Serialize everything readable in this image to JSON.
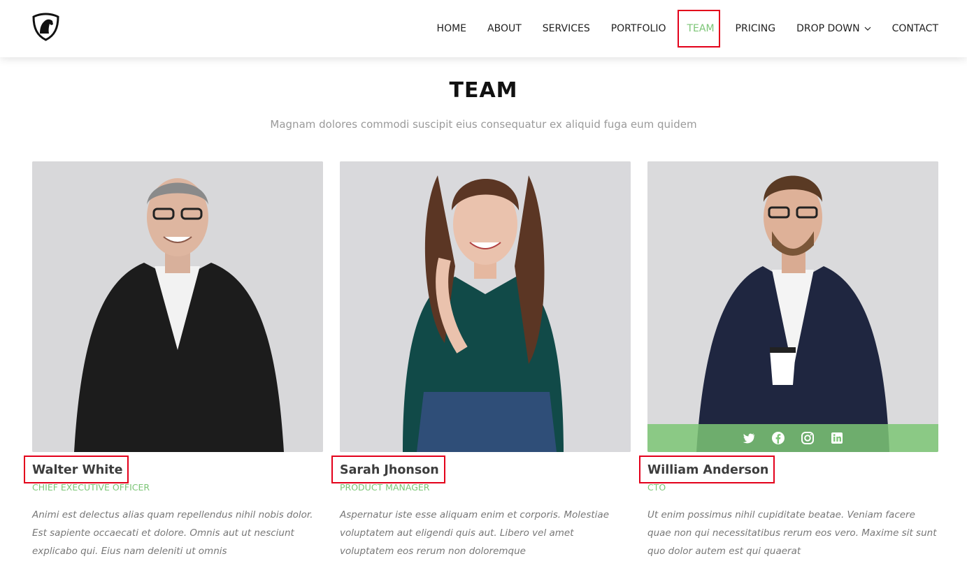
{
  "header": {
    "logo_icon": "horse-head-shield-icon",
    "nav": [
      {
        "label": "HOME",
        "active": false
      },
      {
        "label": "ABOUT",
        "active": false
      },
      {
        "label": "SERVICES",
        "active": false
      },
      {
        "label": "PORTFOLIO",
        "active": false
      },
      {
        "label": "TEAM",
        "active": true
      },
      {
        "label": "PRICING",
        "active": false
      },
      {
        "label": "DROP DOWN",
        "active": false,
        "icon": "chevron-down-icon"
      },
      {
        "label": "CONTACT",
        "active": false
      }
    ]
  },
  "section": {
    "title": "TEAM",
    "subtitle": "Magnam dolores commodi suscipit eius consequatur ex aliquid fuga eum quidem"
  },
  "team": [
    {
      "name": "Walter White",
      "role": "CHIEF EXECUTIVE OFFICER",
      "description": "Animi est delectus alias quam repellendus nihil nobis dolor. Est sapiente occaecati et dolore. Omnis aut ut nesciunt explicabo qui. Eius nam deleniti ut omnis"
    },
    {
      "name": "Sarah Jhonson",
      "role": "PRODUCT MANAGER",
      "description": "Aspernatur iste esse aliquam enim et corporis. Molestiae voluptatem aut eligendi quis aut. Libero vel amet voluptatem eos rerum non doloremque"
    },
    {
      "name": "William Anderson",
      "role": "CTO",
      "description": "Ut enim possimus nihil cupiditate beatae. Veniam facere quae non qui necessitatibus rerum eos vero. Maxime sit sunt quo dolor autem est qui quaerat",
      "social_icons": [
        "twitter-icon",
        "facebook-icon",
        "instagram-icon",
        "linkedin-icon"
      ]
    }
  ],
  "colors": {
    "accent": "#7cc576",
    "highlight": "#e3001b",
    "photo_bg": "#d9d9dc"
  }
}
